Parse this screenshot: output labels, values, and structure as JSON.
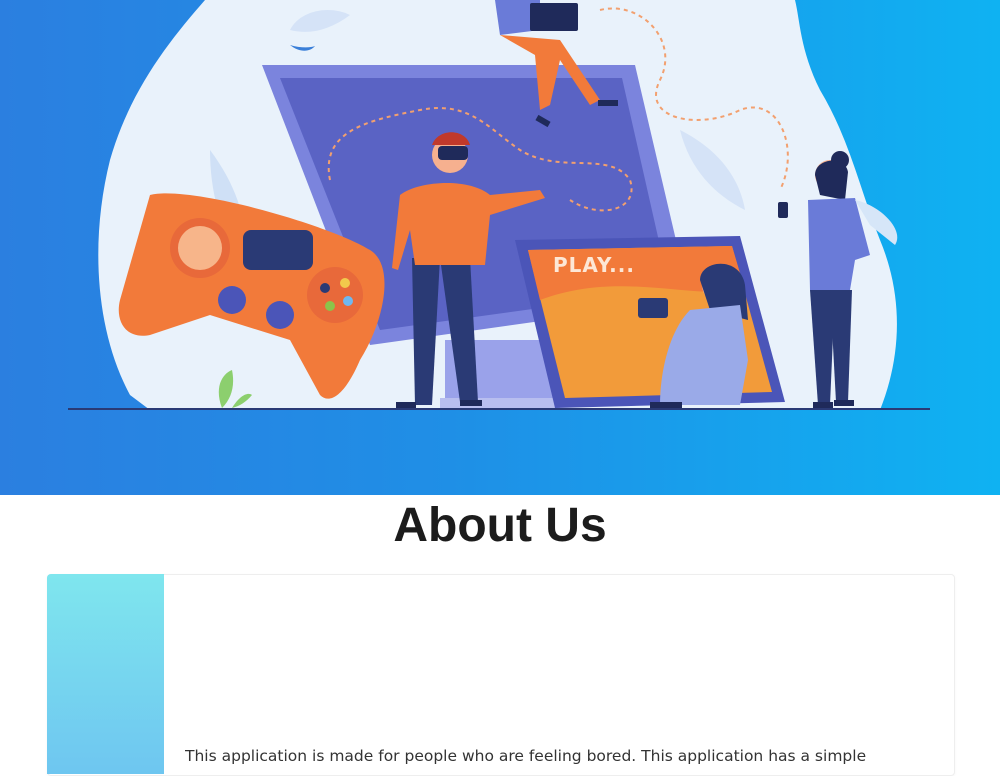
{
  "hero": {
    "illustration": "people-gaming-illustration",
    "screen_text": "PLAY..."
  },
  "about": {
    "title": "About Us",
    "body": "This application is made for people who are feeling bored. This application has a simple"
  },
  "colors": {
    "hero_start": "#2b7fe0",
    "hero_end": "#0fb2f2",
    "accent_orange": "#f27a3a",
    "screen_purple": "#5a63c4",
    "card_accent": "#7fe6ee"
  }
}
